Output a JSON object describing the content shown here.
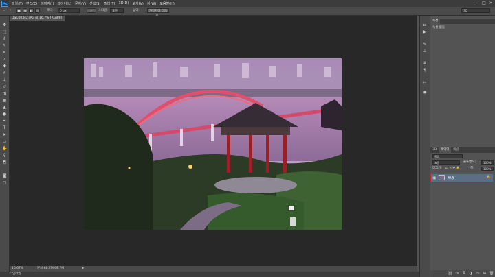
{
  "app": {
    "logo": "Ps"
  },
  "menu": [
    "파일(F)",
    "편집(E)",
    "이미지(I)",
    "레이어(L)",
    "문자(Y)",
    "선택(S)",
    "필터(T)",
    "3D(D)",
    "보기(V)",
    "창(W)",
    "도움말(H)"
  ],
  "window_controls": [
    "–",
    "□",
    "×"
  ],
  "options": {
    "style_label": "페더:",
    "style_value": "0 px",
    "antialias": "앤티 앨리어스",
    "mode_label": "스타일:",
    "mode_value": "표준",
    "button_subtract": "높이:",
    "button_refine": "가장자리 다듬기...",
    "workspace": "3D"
  },
  "document": {
    "tab_title": "DSC00342.JPG @ 16.7% (RGB/8)",
    "close_glyph": "×"
  },
  "status": {
    "zoom": "16.67%",
    "doc_size": "문서:68.7M/68.7M",
    "arrow": "▸"
  },
  "bottom": {
    "tab": "타임라인"
  },
  "panels": {
    "top": {
      "tabs": [
        "속성"
      ],
      "content": "속성 없음"
    },
    "layers": {
      "tabs": [
        "3D",
        "레이어",
        "채널"
      ],
      "kind_label": "종류",
      "blend_mode": "표준",
      "opacity_label": "불투명도:",
      "opacity_value": "100%",
      "lock_label": "잠그기:",
      "fill_label": "칠:",
      "fill_value": "100%",
      "layer_name": "배경",
      "lock_icon": "🔒"
    }
  },
  "colors": {
    "accent": "#d42020",
    "selected_layer": "#5b6e86",
    "ps_blue": "#33a3ff"
  }
}
